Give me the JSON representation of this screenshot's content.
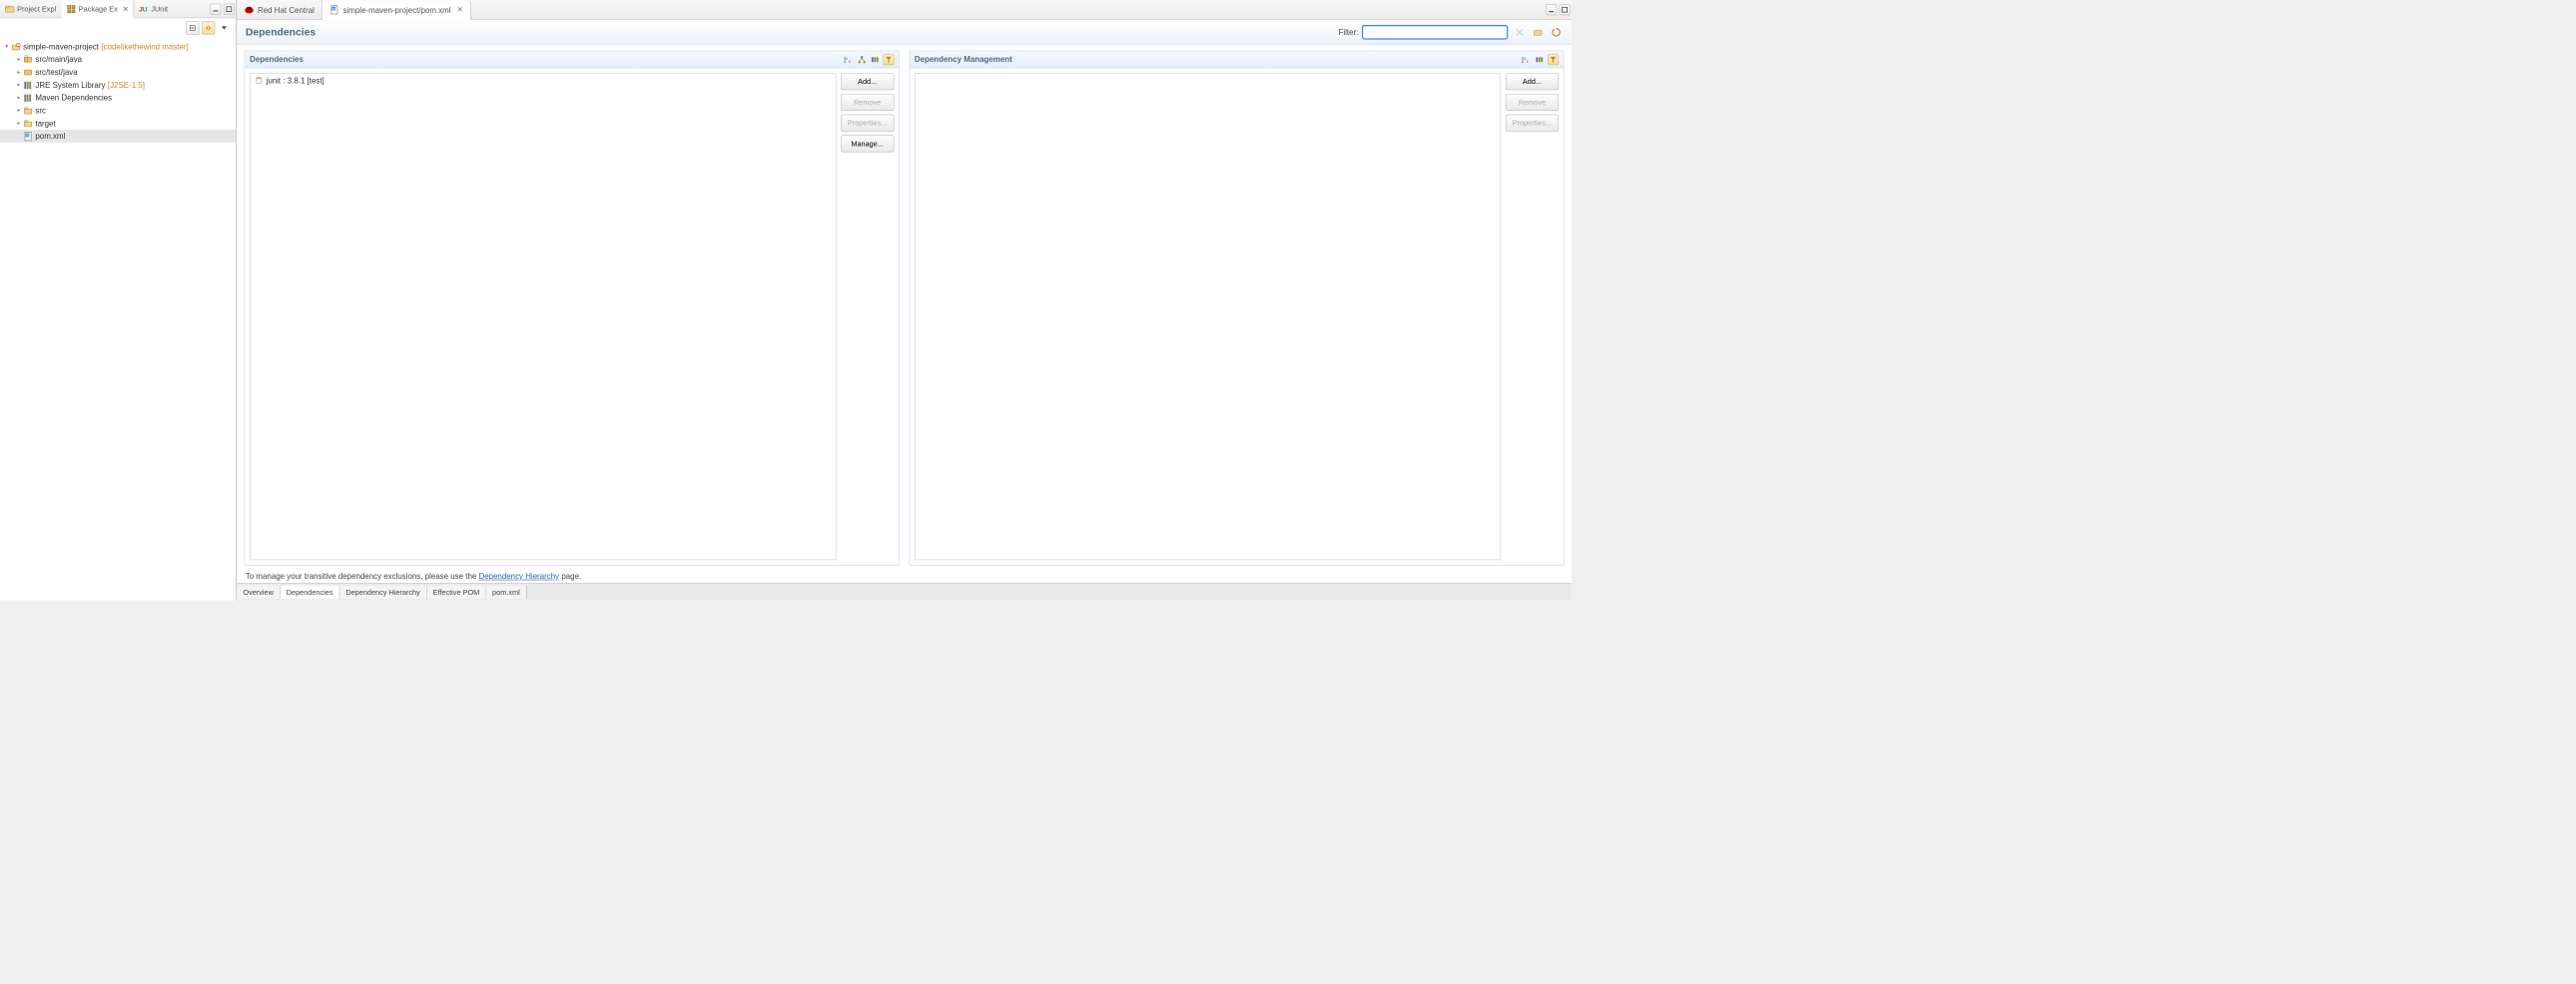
{
  "left": {
    "view_tabs": [
      {
        "label": "Project Expl",
        "active": false
      },
      {
        "label": "Package Ex",
        "active": true
      },
      {
        "label": "JUnit",
        "active": false
      }
    ],
    "tree": {
      "root": {
        "label": "simple-maven-project",
        "decor": "[codelikethewind master]"
      },
      "children": [
        {
          "label": "src/main/java",
          "kind": "pkgfolder"
        },
        {
          "label": "src/test/java",
          "kind": "pkgfolder"
        },
        {
          "label": "JRE System Library",
          "decor": "[J2SE-1.5]",
          "kind": "lib"
        },
        {
          "label": "Maven Dependencies",
          "kind": "lib"
        },
        {
          "label": "src",
          "kind": "folder"
        },
        {
          "label": "target",
          "kind": "folder"
        },
        {
          "label": "pom.xml",
          "kind": "file",
          "selected": true
        }
      ]
    }
  },
  "editor_tabs": [
    {
      "label": "Red Hat Central",
      "active": false
    },
    {
      "label": "simple-maven-project/pom.xml",
      "active": true
    }
  ],
  "form": {
    "title": "Dependencies",
    "filter_label": "Filter:",
    "filter_value": ""
  },
  "sections": {
    "left": {
      "title": "Dependencies",
      "items": [
        {
          "label": "junit : 3.8.1 [test]"
        }
      ],
      "buttons": {
        "add": "Add...",
        "remove": "Remove",
        "properties": "Properties...",
        "manage": "Manage..."
      }
    },
    "right": {
      "title": "Dependency Management",
      "items": [],
      "buttons": {
        "add": "Add...",
        "remove": "Remove",
        "properties": "Properties..."
      }
    }
  },
  "hint": {
    "prefix": "To manage your transitive dependency exclusions, please use the ",
    "link": "Dependency Hierarchy",
    "suffix": " page."
  },
  "bottom_tabs": [
    "Overview",
    "Dependencies",
    "Dependency Hierarchy",
    "Effective POM",
    "pom.xml"
  ],
  "bottom_active": "Dependencies"
}
